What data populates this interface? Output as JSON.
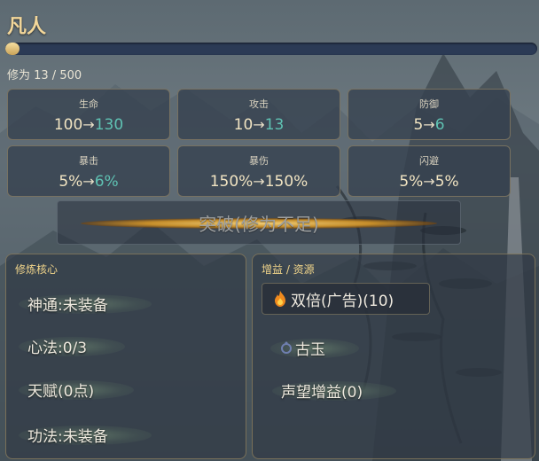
{
  "header": {
    "realm": "凡人",
    "cultivation_label": "修为 13 / 500",
    "cultivation_progress": 0.026
  },
  "stats": [
    {
      "name": "生命",
      "from": "100",
      "to": "130",
      "changed": true
    },
    {
      "name": "攻击",
      "from": "10",
      "to": "13",
      "changed": true
    },
    {
      "name": "防御",
      "from": "5",
      "to": "6",
      "changed": true
    },
    {
      "name": "暴击",
      "from": "5%",
      "to": "6%",
      "changed": true
    },
    {
      "name": "暴伤",
      "from": "150%",
      "to": "150%",
      "changed": false
    },
    {
      "name": "闪避",
      "from": "5%",
      "to": "5%",
      "changed": false
    }
  ],
  "arrow": "→",
  "breakthrough": {
    "label": "突破(修为不足)"
  },
  "core_panel": {
    "title": "修炼核心",
    "items": [
      "神通:未装备",
      "心法:0/3",
      "天赋(0点)",
      "功法:未装备"
    ]
  },
  "resource_panel": {
    "title": "增益 / 资源",
    "items": [
      {
        "label": "双倍(广告)(10)",
        "icon": "fire-icon"
      },
      {
        "label": "古玉",
        "icon": "jade-icon"
      },
      {
        "label": "声望增益(0)",
        "icon": ""
      }
    ]
  },
  "colors": {
    "accent_gold": "#f3d79a",
    "increase_teal": "#5fc2b3",
    "bar_track": "#2b3a55"
  }
}
